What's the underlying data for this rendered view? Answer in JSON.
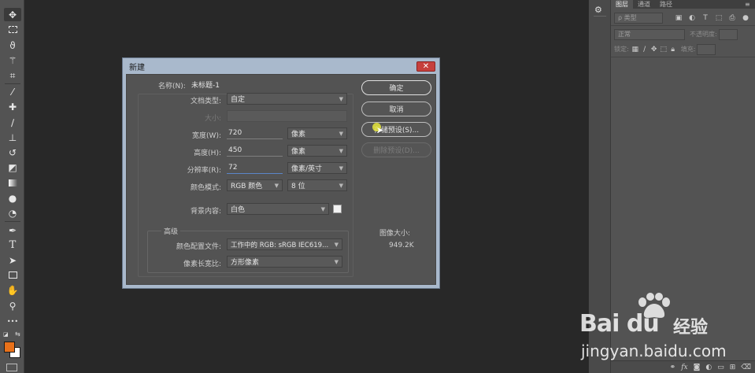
{
  "toolbar": {
    "tools": [
      "move-tool",
      "marquee-tool",
      "lasso-tool",
      "magic-wand-tool",
      "crop-tool",
      "eyedropper-tool",
      "healing-brush-tool",
      "brush-tool",
      "clone-stamp-tool",
      "history-brush-tool",
      "eraser-tool",
      "gradient-tool",
      "blur-tool",
      "dodge-tool",
      "pen-tool",
      "type-tool",
      "path-selection-tool",
      "rectangle-tool",
      "hand-tool",
      "zoom-tool",
      "more-tools"
    ],
    "type_glyph": "T",
    "more_glyph": "•••",
    "foreground_color": "#e8711a",
    "background_color": "#ffffff"
  },
  "layers_panel": {
    "tabs": [
      "图层",
      "通道",
      "路径"
    ],
    "filter_placeholder": "ρ 类型",
    "blend_mode": "正常",
    "opacity_label": "不透明度:",
    "lock_label": "锁定:",
    "fill_label": "填充:"
  },
  "dialog": {
    "title": "新建",
    "close_glyph": "✕",
    "name_label": "名称(N):",
    "name_value": "未标题-1",
    "doc_type_label": "文档类型:",
    "doc_type_value": "自定",
    "size_label": "大小:",
    "width_label": "宽度(W):",
    "width_value": "720",
    "width_unit": "像素",
    "height_label": "高度(H):",
    "height_value": "450",
    "height_unit": "像素",
    "resolution_label": "分辨率(R):",
    "resolution_value": "72",
    "resolution_unit": "像素/英寸",
    "color_mode_label": "颜色模式:",
    "color_mode_value": "RGB 颜色",
    "bit_depth_value": "8 位",
    "background_label": "背景内容:",
    "background_value": "白色",
    "advanced_label": "高级",
    "color_profile_label": "颜色配置文件:",
    "color_profile_value": "工作中的 RGB: sRGB IEC619...",
    "pixel_aspect_label": "像素长宽比:",
    "pixel_aspect_value": "方形像素",
    "ok_label": "确定",
    "cancel_label": "取消",
    "save_preset_label": "存储预设(S)...",
    "delete_preset_label": "删除预设(D)...",
    "image_size_label": "图像大小:",
    "image_size_value": "949.2K"
  },
  "watermark": {
    "brand": "Bai du",
    "brand_cn": "经验",
    "url": "jingyan.baidu.com"
  }
}
